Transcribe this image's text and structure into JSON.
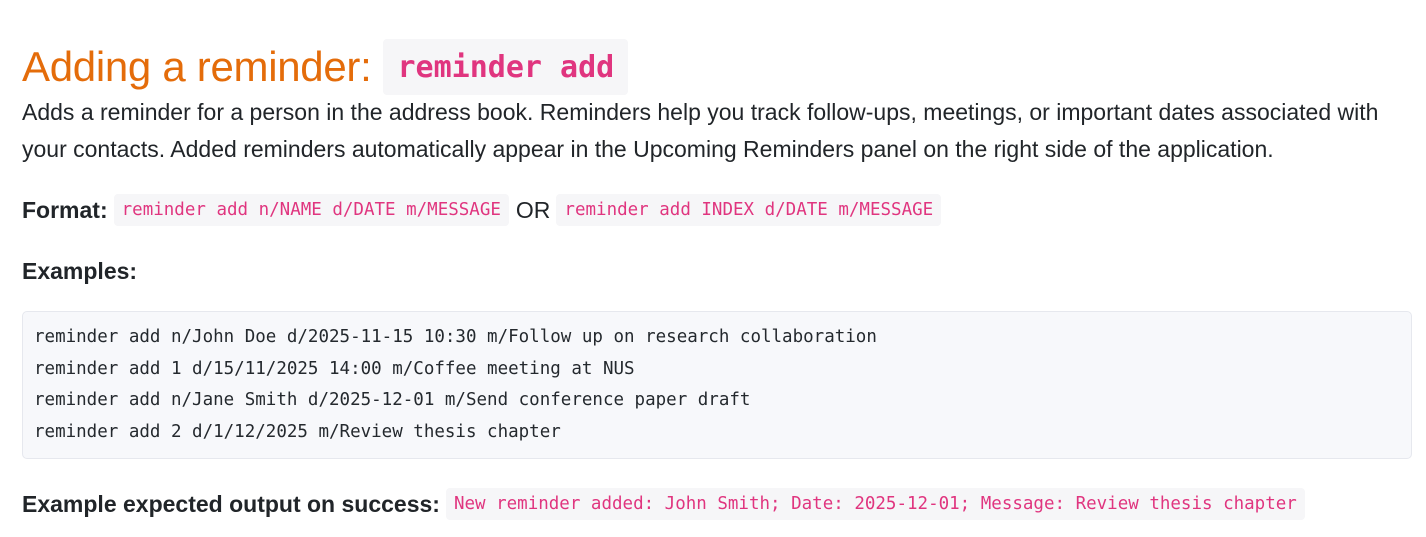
{
  "heading": {
    "text": "Adding a reminder:",
    "code": "reminder add"
  },
  "description": "Adds a reminder for a person in the address book. Reminders help you track follow-ups, meetings, or important dates associated with your contacts. Added reminders automatically appear in the Upcoming Reminders panel on the right side of the application.",
  "format": {
    "label": "Format:",
    "code_by_name": "reminder add n/NAME d/DATE m/MESSAGE",
    "or_text": "OR",
    "code_by_index": "reminder add INDEX d/DATE m/MESSAGE"
  },
  "examples": {
    "label": "Examples:",
    "lines": [
      "reminder add n/John Doe d/2025-11-15 10:30 m/Follow up on research collaboration",
      "reminder add 1 d/15/11/2025 14:00 m/Coffee meeting at NUS",
      "reminder add n/Jane Smith d/2025-12-01 m/Send conference paper draft",
      "reminder add 2 d/1/12/2025 m/Review thesis chapter"
    ]
  },
  "expected_output": {
    "label": "Example expected output on success:",
    "code": "New reminder added: John Smith; Date: 2025-12-01; Message: Review thesis chapter"
  },
  "colors": {
    "heading": "#e46c0a",
    "inline_code_text": "#e0357f",
    "code_background": "#f6f6f8",
    "body_text": "#212529"
  }
}
